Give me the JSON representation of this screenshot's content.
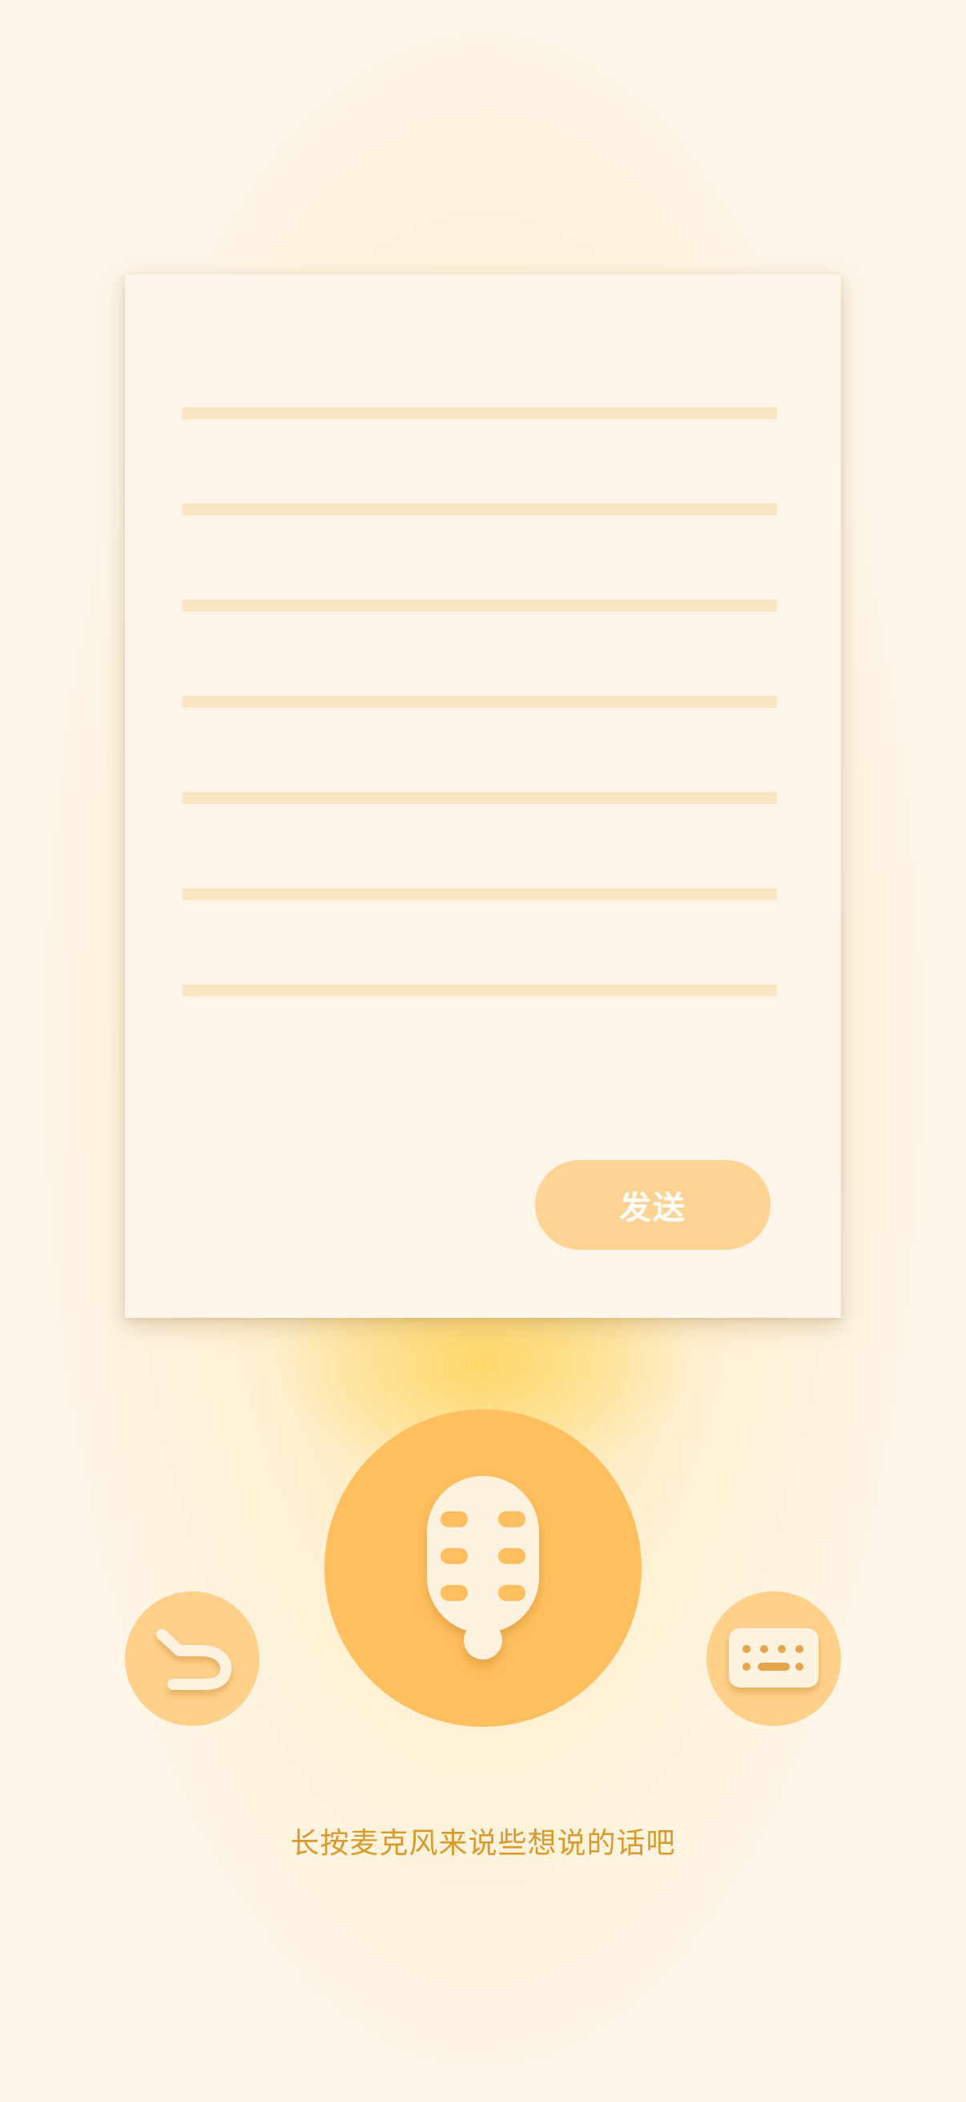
{
  "composer": {
    "send_label": "发送",
    "line_count": 7
  },
  "controls": {
    "mic_icon": "microphone-icon",
    "undo_icon": "undo-icon",
    "keyboard_icon": "keyboard-icon"
  },
  "hint": {
    "text": "长按麦克风来说些想说的话吧"
  },
  "colors": {
    "background": "#fdf5e8",
    "paper": "#fdf5e9",
    "rule": "#fbe6c4",
    "send_button": "#ffd393",
    "mic_button": "#ffbf5e",
    "side_button": "#ffd08a",
    "icon": "#fdf1df",
    "hint_text": "#d99a2b"
  }
}
